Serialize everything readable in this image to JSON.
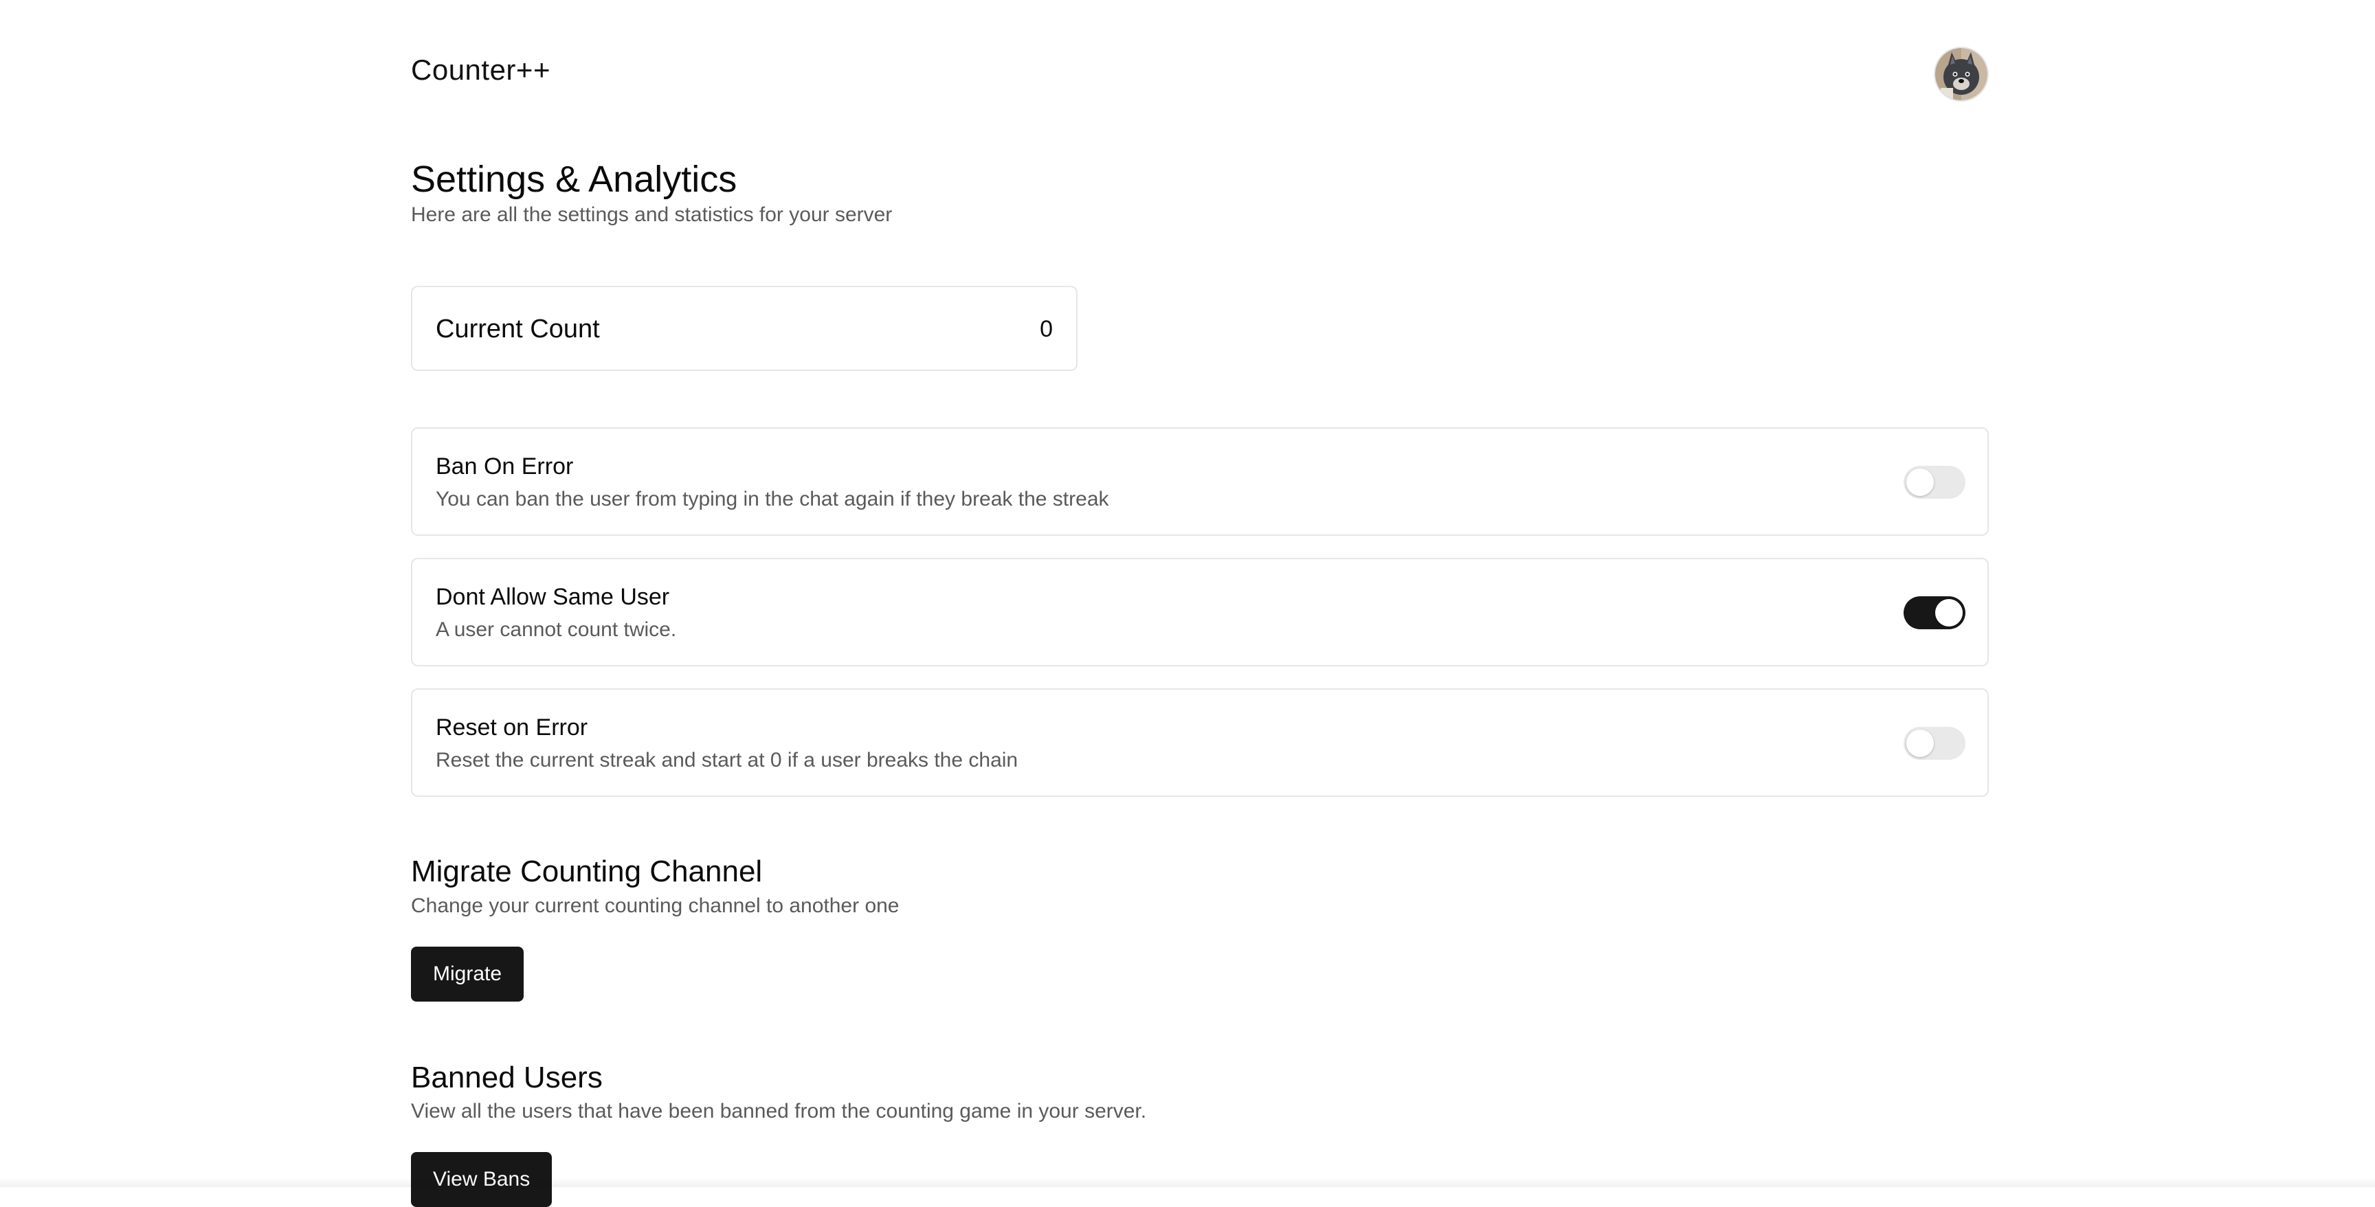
{
  "header": {
    "brand": "Counter++",
    "avatar_icon": "wolf-avatar-icon"
  },
  "page": {
    "title": "Settings & Analytics",
    "subtitle": "Here are all the settings and statistics for your server"
  },
  "count_card": {
    "label": "Current Count",
    "value": "0"
  },
  "settings": [
    {
      "title": "Ban On Error",
      "description": "You can ban the user from typing in the chat again if they break the streak",
      "enabled": false
    },
    {
      "title": "Dont Allow Same User",
      "description": "A user cannot count twice.",
      "enabled": true
    },
    {
      "title": "Reset on Error",
      "description": "Reset the current streak and start at 0 if a user breaks the chain",
      "enabled": false
    }
  ],
  "migrate": {
    "title": "Migrate Counting Channel",
    "description": "Change your current counting channel to another one",
    "button_label": "Migrate"
  },
  "banned": {
    "title": "Banned Users",
    "description": "View all the users that have been banned from the counting game in your server.",
    "button_label": "View Bans"
  },
  "colors": {
    "toggle_on": "#171717",
    "toggle_off": "#e9e9e9",
    "button_bg": "#171717",
    "muted_text": "#5a5a5a",
    "border": "#e6e6e6"
  }
}
